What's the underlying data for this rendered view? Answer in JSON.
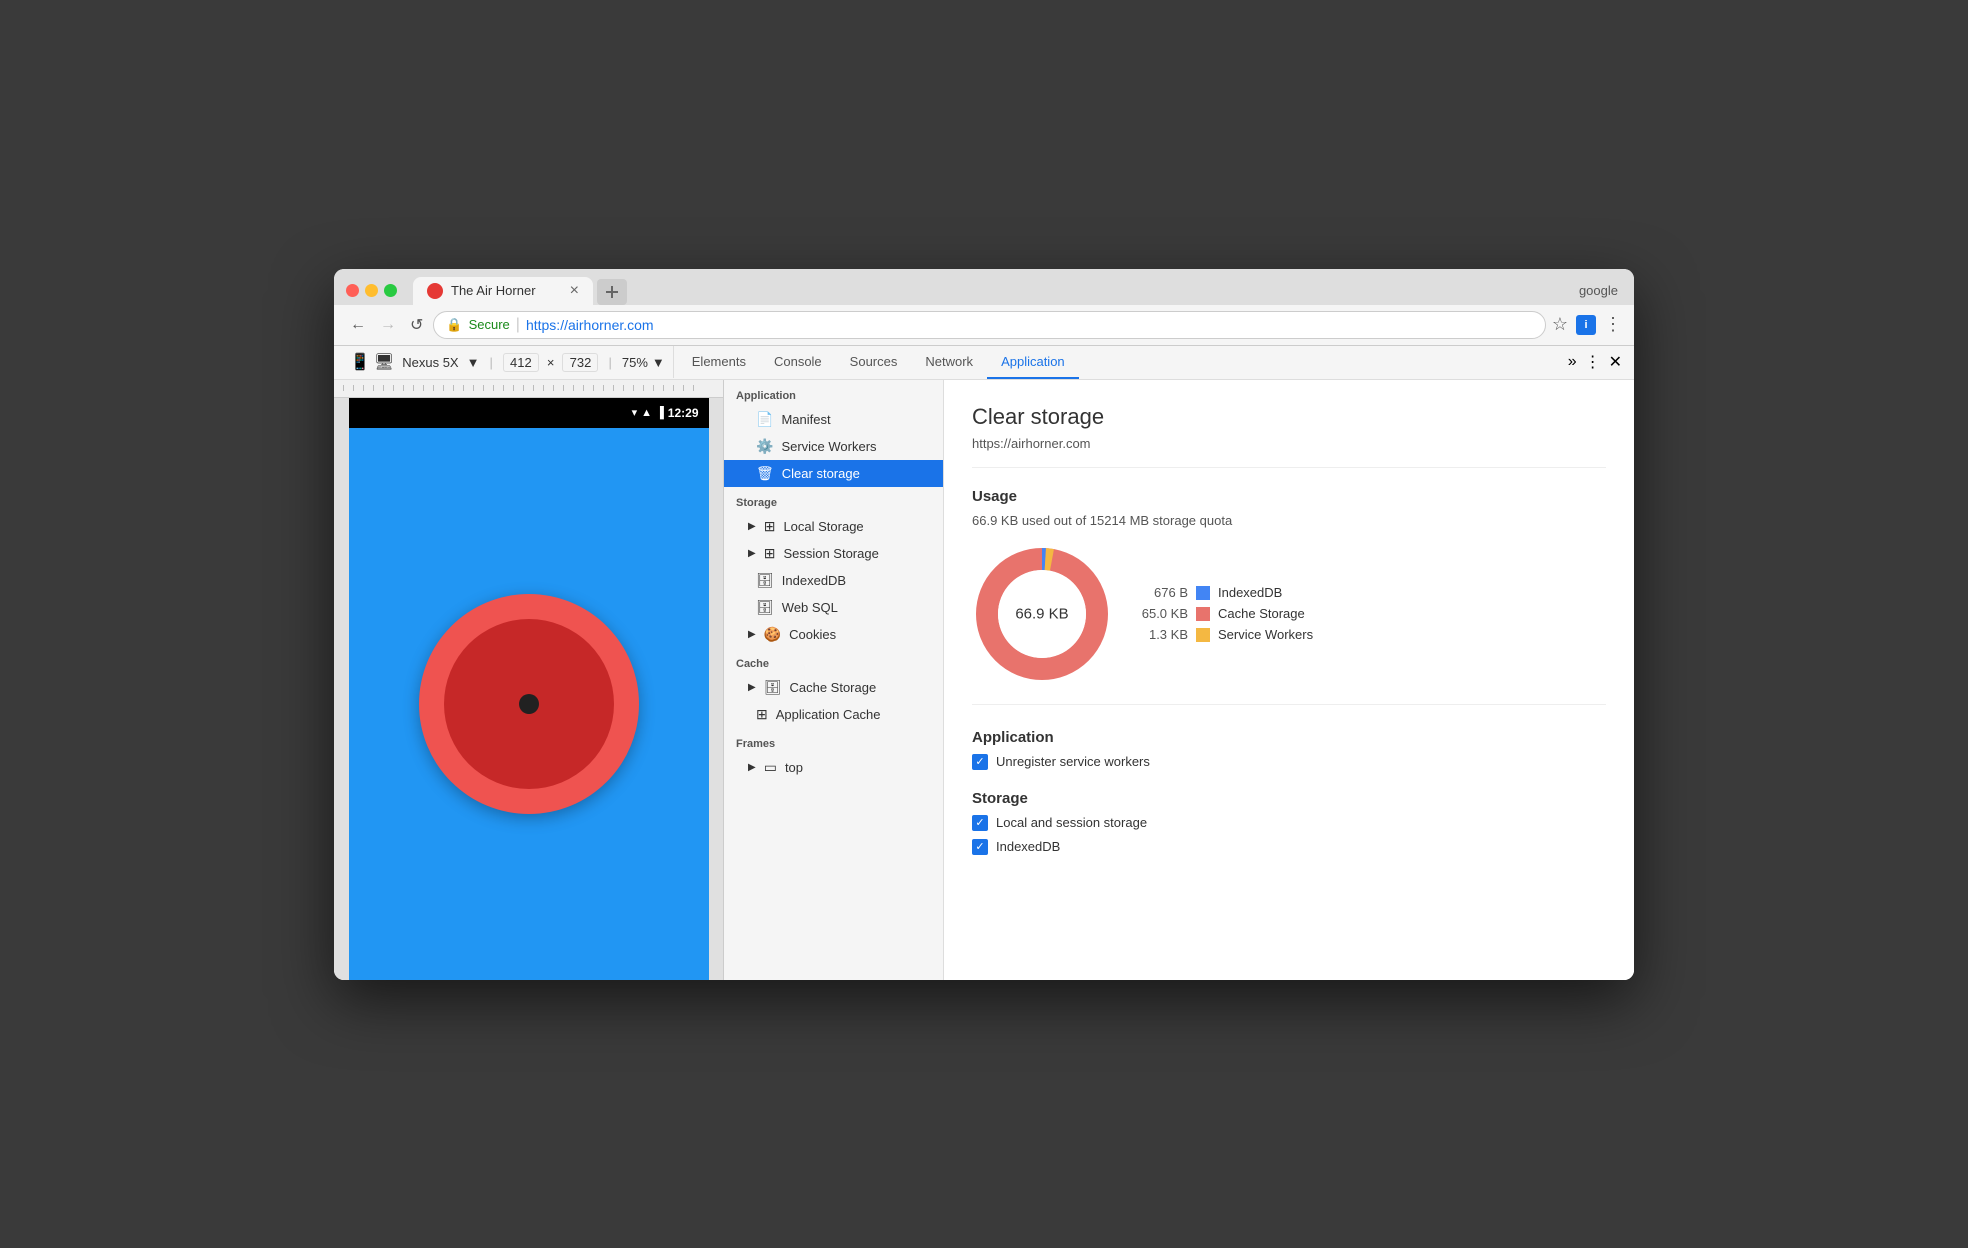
{
  "browser": {
    "title": "The Air Horner",
    "url_secure": "Secure",
    "url_separator": "|",
    "url_protocol": "https://",
    "url_domain": "airhorner.com",
    "google_account": "google",
    "tab_close": "×"
  },
  "devtools_toolbar": {
    "device": "Nexus 5X",
    "width": "412",
    "x": "×",
    "height": "732",
    "zoom": "75%"
  },
  "devtools_tabs": [
    {
      "label": "Elements",
      "active": false
    },
    {
      "label": "Console",
      "active": false
    },
    {
      "label": "Sources",
      "active": false
    },
    {
      "label": "Network",
      "active": false
    },
    {
      "label": "Application",
      "active": true
    }
  ],
  "sidebar": {
    "application_label": "Application",
    "items_app": [
      {
        "icon": "📄",
        "label": "Manifest",
        "active": false,
        "arrow": ""
      },
      {
        "icon": "⚙️",
        "label": "Service Workers",
        "active": false,
        "arrow": ""
      },
      {
        "icon": "🗑",
        "label": "Clear storage",
        "active": true,
        "arrow": ""
      }
    ],
    "storage_label": "Storage",
    "items_storage": [
      {
        "icon": "▦",
        "label": "Local Storage",
        "active": false,
        "arrow": "▶"
      },
      {
        "icon": "▦",
        "label": "Session Storage",
        "active": false,
        "arrow": "▶"
      },
      {
        "icon": "🗄",
        "label": "IndexedDB",
        "active": false,
        "arrow": ""
      },
      {
        "icon": "🗄",
        "label": "Web SQL",
        "active": false,
        "arrow": ""
      },
      {
        "icon": "🍪",
        "label": "Cookies",
        "active": false,
        "arrow": "▶"
      }
    ],
    "cache_label": "Cache",
    "items_cache": [
      {
        "icon": "🗄",
        "label": "Cache Storage",
        "active": false,
        "arrow": "▶"
      },
      {
        "icon": "▦",
        "label": "Application Cache",
        "active": false,
        "arrow": ""
      }
    ],
    "frames_label": "Frames",
    "items_frames": [
      {
        "icon": "▭",
        "label": "top",
        "active": false,
        "arrow": "▶"
      }
    ]
  },
  "panel": {
    "title": "Clear storage",
    "url": "https://airhorner.com",
    "usage_section": "Usage",
    "usage_text": "66.9 KB used out of 15214 MB storage quota",
    "donut_label": "66.9 KB",
    "legend": [
      {
        "label": "IndexedDB",
        "value": "676 B",
        "color": "#4285f4"
      },
      {
        "label": "Cache Storage",
        "value": "65.0 KB",
        "color": "#e8736c"
      },
      {
        "label": "Service Workers",
        "value": "1.3 KB",
        "color": "#f4b842"
      }
    ],
    "application_section": "Application",
    "checkboxes_app": [
      {
        "label": "Unregister service workers",
        "checked": true
      }
    ],
    "storage_section": "Storage",
    "checkboxes_storage": [
      {
        "label": "Local and session storage",
        "checked": true
      },
      {
        "label": "IndexedDB",
        "checked": true
      }
    ]
  },
  "phone": {
    "status_time": "12:29"
  },
  "nav": {
    "back": "←",
    "forward": "→",
    "reload": "↺"
  }
}
